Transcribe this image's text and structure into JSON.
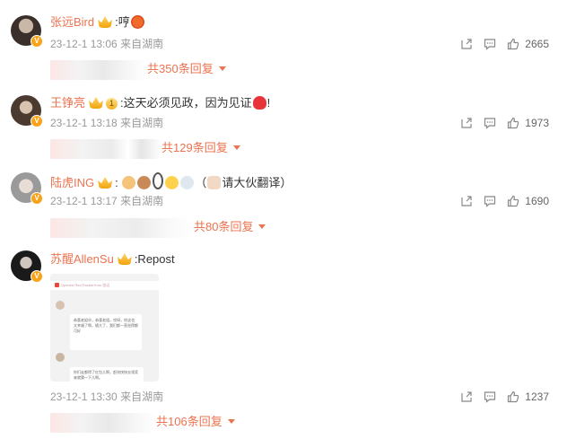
{
  "comments": [
    {
      "username": "张远Bird",
      "text": ":哼",
      "time": "23-12-1 13:06",
      "location": "来自湖南",
      "likes": "2665",
      "reply_link": "共350条回复"
    },
    {
      "username": "王铮亮",
      "level": "1",
      "text": ":这天必须见政，因为见证",
      "tail": "!",
      "time": "23-12-1 13:18",
      "location": "来自湖南",
      "likes": "1973",
      "reply_link": "共129条回复"
    },
    {
      "username": "陆虎ING",
      "text": ":",
      "tail": "（",
      "tail2": "请大伙翻译）",
      "time": "23-12-1 13:17",
      "location": "来自湖南",
      "likes": "1690",
      "reply_link": "共80条回复"
    },
    {
      "username": "苏醒AllenSu",
      "text": ":Repost",
      "time": "23-12-1 13:30",
      "location": "来自湖南",
      "likes": "1237",
      "reply_link": "共106条回复",
      "image_texts": {
        "header": "Opened Red Packet from 张远",
        "msg1": "恭喜老姐😄，恭喜老姐，哎呀，你这也太幸福了啊，随大了，我们都一直觉得都可好",
        "msg2": "你们走都得了红包儿啊，赶快快快去领奖来就猜一下儿啊。"
      }
    }
  ],
  "colors": {
    "username": "#eb7350",
    "meta": "#999999",
    "accent": "#f9a31a"
  },
  "icons": [
    "share-icon",
    "comment-icon",
    "like-icon",
    "crown-badge-icon",
    "verified-v-icon"
  ]
}
